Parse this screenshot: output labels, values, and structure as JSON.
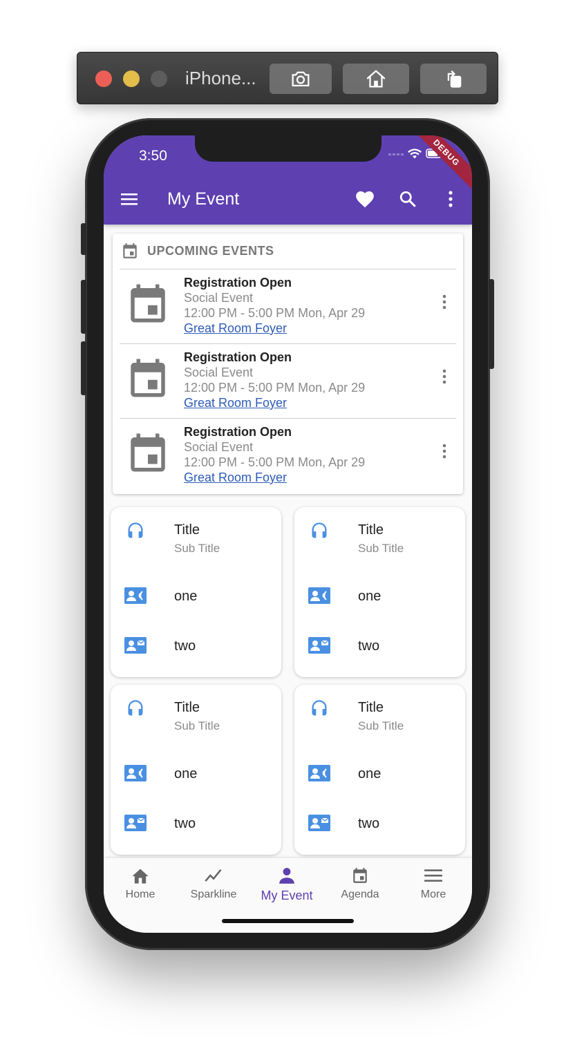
{
  "simulator": {
    "title": "iPhone...",
    "buttons": [
      "screenshot-icon",
      "home-icon",
      "rotate-icon"
    ]
  },
  "status_bar": {
    "time": "3:50",
    "debug_banner": "DEBUG"
  },
  "app_bar": {
    "title": "My Event",
    "actions": [
      "favorite-icon",
      "search-icon",
      "more-vert-icon"
    ],
    "color": "#5e40b0"
  },
  "upcoming": {
    "header": "UPCOMING EVENTS",
    "events": [
      {
        "title": "Registration Open",
        "type": "Social Event",
        "time": "12:00 PM - 5:00 PM Mon, Apr 29",
        "location": "Great Room Foyer"
      },
      {
        "title": "Registration Open",
        "type": "Social Event",
        "time": "12:00 PM - 5:00 PM Mon, Apr 29",
        "location": "Great Room Foyer"
      },
      {
        "title": "Registration Open",
        "type": "Social Event",
        "time": "12:00 PM - 5:00 PM Mon, Apr 29",
        "location": "Great Room Foyer"
      }
    ]
  },
  "cards": [
    {
      "title": "Title",
      "subtitle": "Sub Title",
      "line1": "one",
      "line2": "two"
    },
    {
      "title": "Title",
      "subtitle": "Sub Title",
      "line1": "one",
      "line2": "two"
    },
    {
      "title": "Title",
      "subtitle": "Sub Title",
      "line1": "one",
      "line2": "two"
    },
    {
      "title": "Title",
      "subtitle": "Sub Title",
      "line1": "one",
      "line2": "two"
    }
  ],
  "bottom_nav": {
    "items": [
      {
        "label": "Home",
        "icon": "home-icon"
      },
      {
        "label": "Sparkline",
        "icon": "sparkline-icon"
      },
      {
        "label": "My Event",
        "icon": "person-icon",
        "active": true
      },
      {
        "label": "Agenda",
        "icon": "calendar-icon"
      },
      {
        "label": "More",
        "icon": "menu-icon"
      }
    ]
  },
  "colors": {
    "accent_icon": "#4a90e2",
    "link": "#2d5bb8",
    "debug": "#a3263e"
  }
}
